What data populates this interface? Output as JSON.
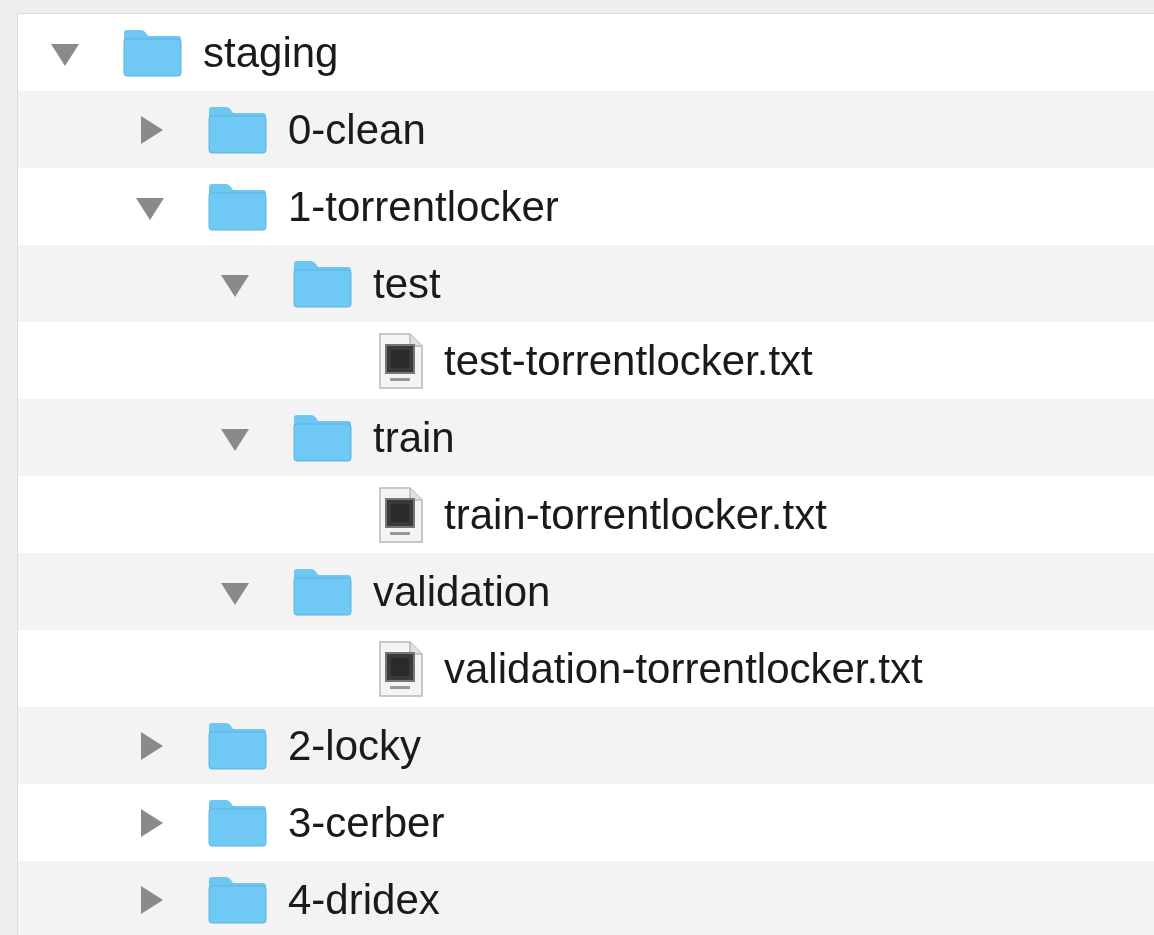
{
  "tree": [
    {
      "kind": "folder",
      "name": "staging",
      "expanded": true,
      "children": [
        {
          "kind": "folder",
          "name": "0-clean",
          "expanded": false
        },
        {
          "kind": "folder",
          "name": "1-torrentlocker",
          "expanded": true,
          "children": [
            {
              "kind": "folder",
              "name": "test",
              "expanded": true,
              "children": [
                {
                  "kind": "file",
                  "name": "test-torrentlocker.txt"
                }
              ]
            },
            {
              "kind": "folder",
              "name": "train",
              "expanded": true,
              "children": [
                {
                  "kind": "file",
                  "name": "train-torrentlocker.txt"
                }
              ]
            },
            {
              "kind": "folder",
              "name": "validation",
              "expanded": true,
              "children": [
                {
                  "kind": "file",
                  "name": "validation-torrentlocker.txt"
                }
              ]
            }
          ]
        },
        {
          "kind": "folder",
          "name": "2-locky",
          "expanded": false
        },
        {
          "kind": "folder",
          "name": "3-cerber",
          "expanded": false
        },
        {
          "kind": "folder",
          "name": "4-dridex",
          "expanded": false
        }
      ]
    }
  ]
}
